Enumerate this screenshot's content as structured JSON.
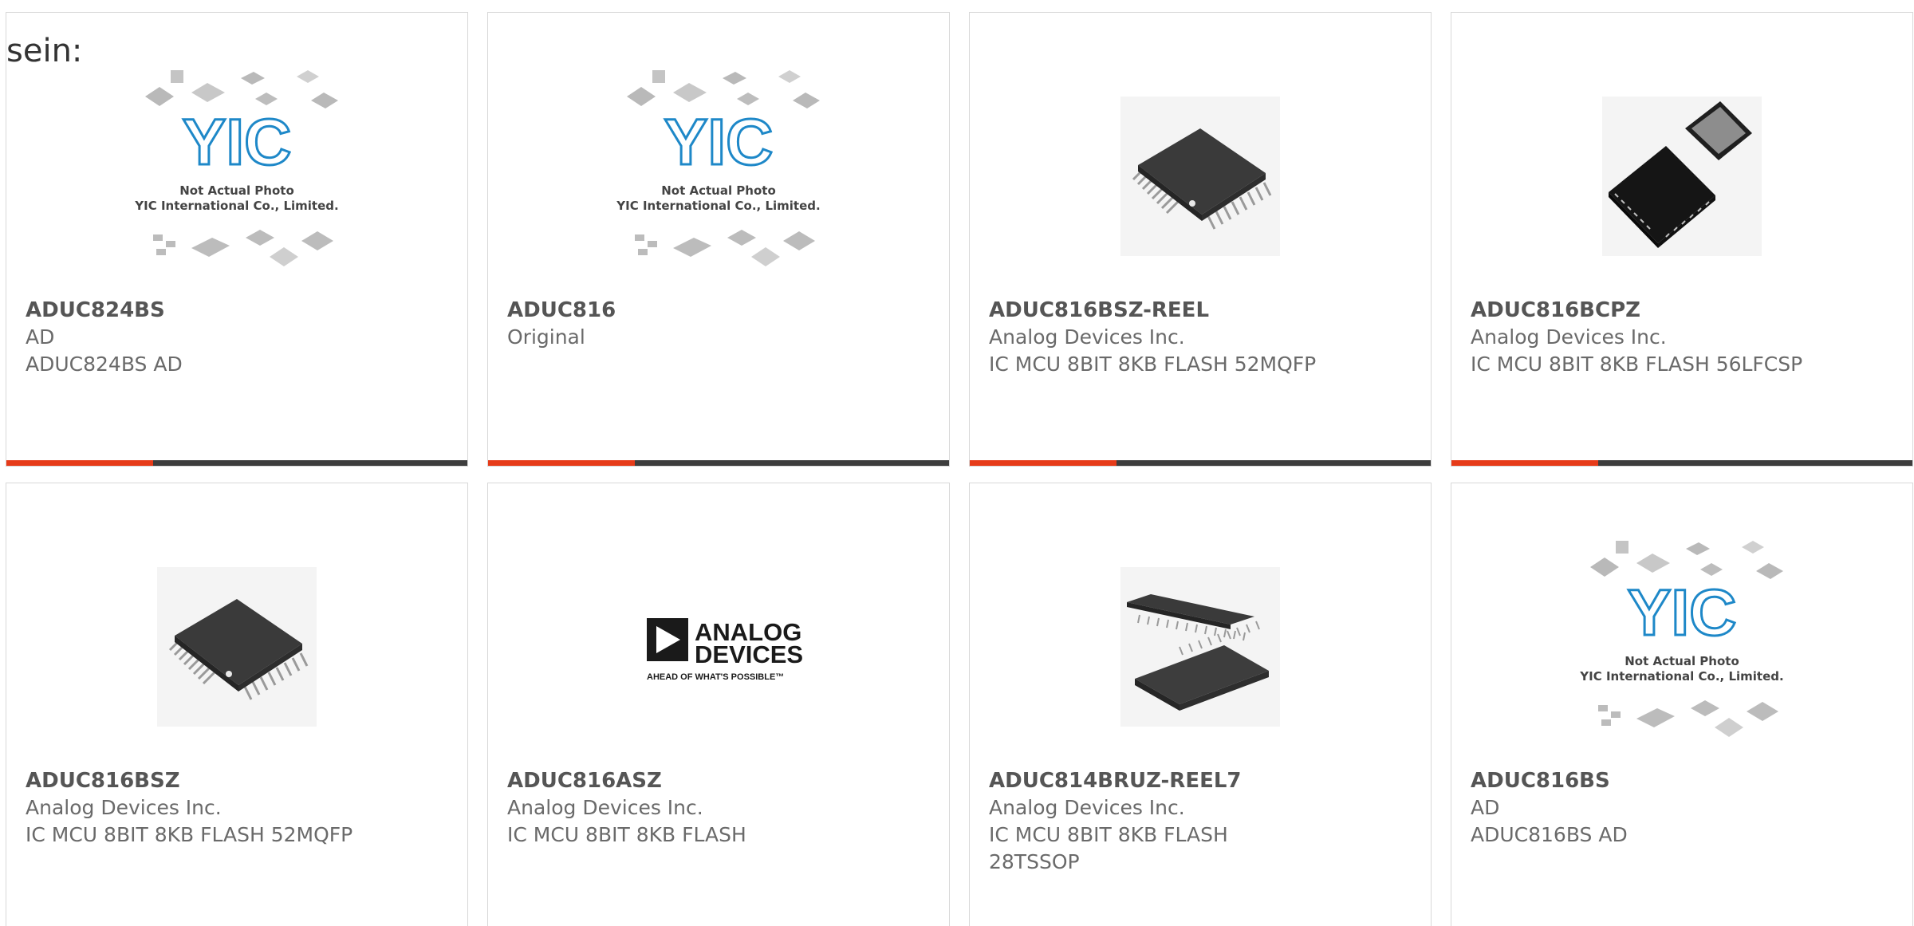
{
  "intro_text": "sein:",
  "placeholder_caption_line1": "Not Actual Photo",
  "placeholder_caption_line2": "YIC International Co., Limited.",
  "placeholder_logo_text": "YIC",
  "analog_logo_line1": "ANALOG",
  "analog_logo_line2": "DEVICES",
  "analog_logo_tagline": "AHEAD OF WHAT'S POSSIBLE™",
  "colors": {
    "accent": "#e63b19",
    "bar": "#3d3d3d",
    "border": "#d8d8d8",
    "yic_blue": "#1e88c8"
  },
  "products": [
    {
      "part": "ADUC824BS",
      "manufacturer": "AD",
      "description": "ADUC824BS AD",
      "image": "yic-placeholder"
    },
    {
      "part": "ADUC816",
      "manufacturer": "Original",
      "description": "",
      "image": "yic-placeholder"
    },
    {
      "part": "ADUC816BSZ-REEL",
      "manufacturer": "Analog Devices Inc.",
      "description": "IC MCU 8BIT 8KB FLASH 52MQFP",
      "image": "qfp-chip-photo"
    },
    {
      "part": "ADUC816BCPZ",
      "manufacturer": "Analog Devices Inc.",
      "description": "IC MCU 8BIT 8KB FLASH 56LFCSP",
      "image": "lfcsp-chip-photo"
    },
    {
      "part": "ADUC816BSZ",
      "manufacturer": "Analog Devices Inc.",
      "description": "IC MCU 8BIT 8KB FLASH 52MQFP",
      "image": "qfp-chip-photo"
    },
    {
      "part": "ADUC816ASZ",
      "manufacturer": "Analog Devices Inc.",
      "description": "IC MCU 8BIT 8KB FLASH",
      "image": "analog-devices-logo"
    },
    {
      "part": "ADUC814BRUZ-REEL7",
      "manufacturer": "Analog Devices Inc.",
      "description": "IC MCU 8BIT 8KB FLASH 28TSSOP",
      "image": "tssop-chip-photo"
    },
    {
      "part": "ADUC816BS",
      "manufacturer": "AD",
      "description": "ADUC816BS AD",
      "image": "yic-placeholder"
    }
  ]
}
